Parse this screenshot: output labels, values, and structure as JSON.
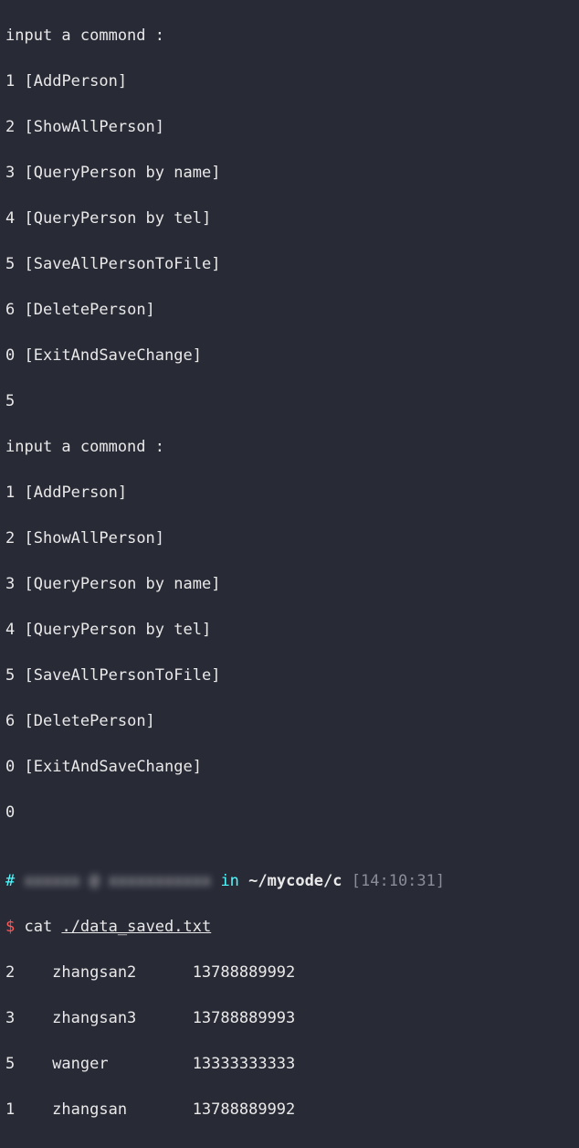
{
  "prompt": "input a commond :",
  "menu": [
    {
      "num": "1",
      "label": "[AddPerson]"
    },
    {
      "num": "2",
      "label": "[ShowAllPerson]"
    },
    {
      "num": "3",
      "label": "[QueryPerson by name]"
    },
    {
      "num": "4",
      "label": "[QueryPerson by tel]"
    },
    {
      "num": "5",
      "label": "[SaveAllPersonToFile]"
    },
    {
      "num": "6",
      "label": "[DeletePerson]"
    },
    {
      "num": "0",
      "label": "[ExitAndSaveChange]"
    }
  ],
  "first_input": "5",
  "second_input": "0",
  "blank": "",
  "ps1": {
    "hash": "#",
    "in": " in ",
    "path": "~/mycode/c",
    "time_open": " [",
    "time": "14:10:31",
    "time_close": "]"
  },
  "catline": {
    "dollar": "$",
    "sp": " ",
    "cmd": "cat ",
    "file": "./data_saved.txt"
  },
  "rows": [
    {
      "id": "2",
      "name": "zhangsan2",
      "tel": "13788889992"
    },
    {
      "id": "3",
      "name": "zhangsan3",
      "tel": "13788889993"
    },
    {
      "id": "5",
      "name": "wanger",
      "tel": "13333333333"
    },
    {
      "id": "1",
      "name": "zhangsan",
      "tel": "13788889992"
    }
  ],
  "rows_padded": [
    {
      "line": "2    zhangsan2      13788889992"
    },
    {
      "line": "3    zhangsan3      13788889993"
    },
    {
      "line": "5    wanger         13333333333"
    },
    {
      "line": "1    zhangsan       13788889992"
    }
  ]
}
